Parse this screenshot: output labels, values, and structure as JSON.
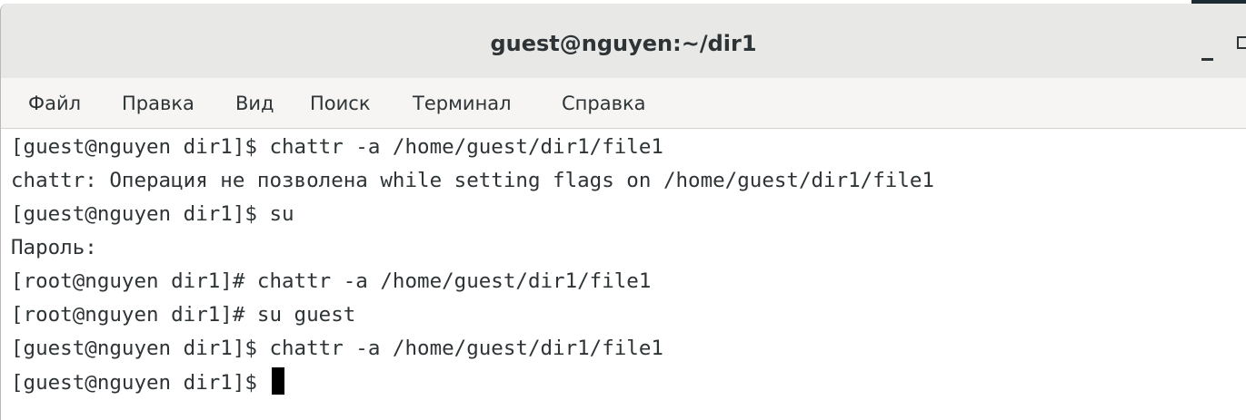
{
  "window": {
    "title": "guest@nguyen:~/dir1"
  },
  "menu": {
    "items": [
      "Файл",
      "Правка",
      "Вид",
      "Поиск",
      "Терминал",
      "Справка"
    ]
  },
  "terminal": {
    "lines": [
      "[guest@nguyen dir1]$ chattr -a /home/guest/dir1/file1",
      "chattr: Операция не позволена while setting flags on /home/guest/dir1/file1",
      "[guest@nguyen dir1]$ su",
      "Пароль:",
      "[root@nguyen dir1]# chattr -a /home/guest/dir1/file1",
      "[root@nguyen dir1]# su guest",
      "[guest@nguyen dir1]$ chattr -a /home/guest/dir1/file1",
      "[guest@nguyen dir1]$ "
    ]
  },
  "icons": {
    "minimize": "minimize-icon",
    "maximize": "maximize-icon"
  }
}
